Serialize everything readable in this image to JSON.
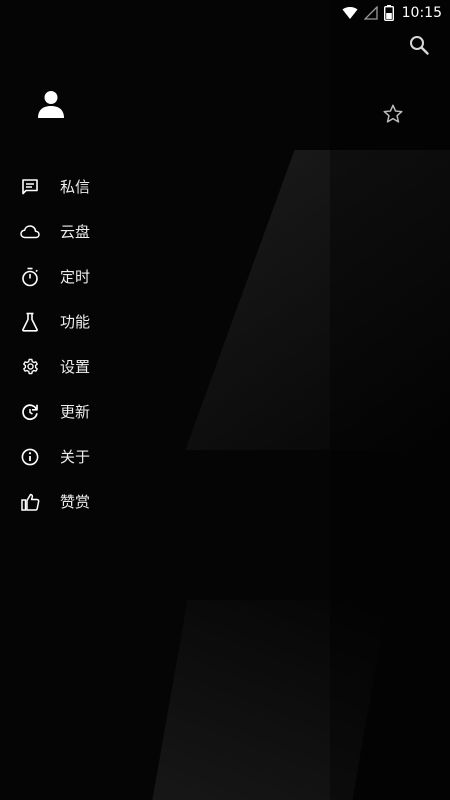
{
  "status_bar": {
    "time": "10:15",
    "icons": [
      "wifi-icon",
      "signal-icon",
      "battery-icon"
    ]
  },
  "toolbar": {
    "search_icon": "search-icon",
    "favorite_icon": "star-icon"
  },
  "drawer": {
    "avatar_icon": "user-avatar-icon",
    "items": [
      {
        "label": "私信",
        "icon": "message-icon"
      },
      {
        "label": "云盘",
        "icon": "cloud-icon"
      },
      {
        "label": "定时",
        "icon": "stopwatch-icon"
      },
      {
        "label": "功能",
        "icon": "flask-icon"
      },
      {
        "label": "设置",
        "icon": "gear-icon"
      },
      {
        "label": "更新",
        "icon": "refresh-icon"
      },
      {
        "label": "关于",
        "icon": "info-icon"
      },
      {
        "label": "赞赏",
        "icon": "thumbs-up-icon"
      }
    ]
  },
  "colors": {
    "background": "#050505",
    "text": "#ededed",
    "icon": "#ffffff"
  }
}
